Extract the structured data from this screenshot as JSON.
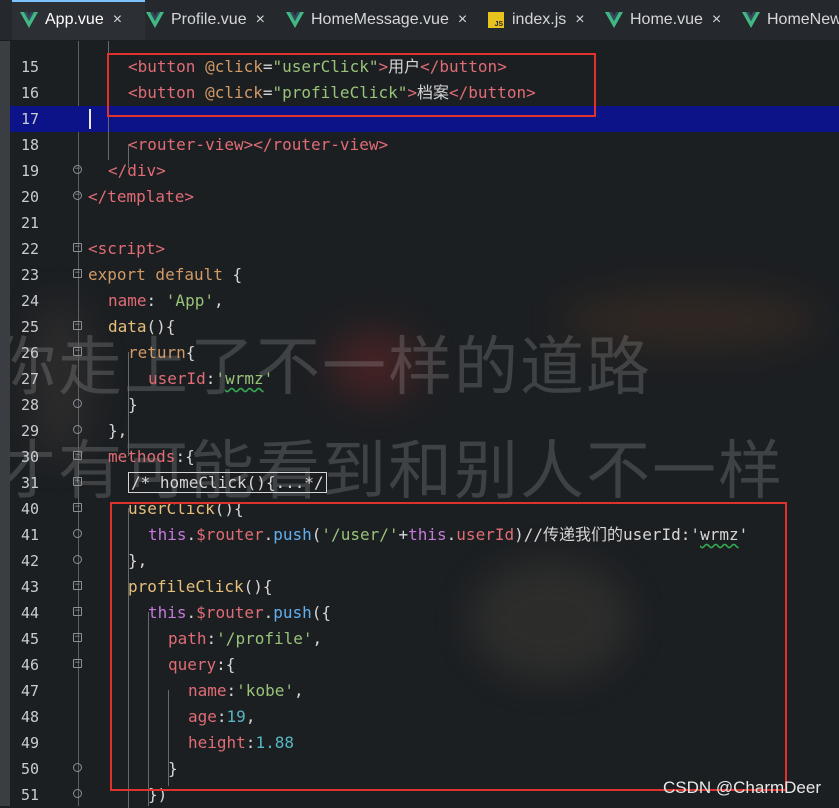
{
  "tabs": [
    {
      "label": "App.vue",
      "icon": "vue-icon",
      "active": true
    },
    {
      "label": "Profile.vue",
      "icon": "vue-icon",
      "active": false
    },
    {
      "label": "HomeMessage.vue",
      "icon": "vue-icon",
      "active": false
    },
    {
      "label": "index.js",
      "icon": "js-icon",
      "active": false
    },
    {
      "label": "Home.vue",
      "icon": "vue-icon",
      "active": false
    },
    {
      "label": "HomeNew",
      "icon": "vue-icon",
      "active": false
    }
  ],
  "close_glyph": "×",
  "background_text": {
    "line1": "你走上了不一样的道路",
    "line2": "才有可能看到和别人不一样"
  },
  "lines": [
    {
      "num": "15",
      "tokens": [
        [
          "t-tag",
          "<button "
        ],
        [
          "t-attr",
          "@click"
        ],
        [
          "t-plain",
          "="
        ],
        [
          "t-str",
          "\"userClick\""
        ],
        [
          "t-tag",
          ">"
        ],
        [
          "t-text",
          "用户"
        ],
        [
          "t-tag",
          "</button>"
        ]
      ]
    },
    {
      "num": "16",
      "tokens": [
        [
          "t-tag",
          "<button "
        ],
        [
          "t-attr",
          "@click"
        ],
        [
          "t-plain",
          "="
        ],
        [
          "t-str",
          "\"profileClick\""
        ],
        [
          "t-tag",
          ">"
        ],
        [
          "t-text",
          "档案"
        ],
        [
          "t-tag",
          "</button>"
        ]
      ]
    },
    {
      "num": "17",
      "tokens": []
    },
    {
      "num": "18",
      "tokens": [
        [
          "t-tag",
          "<router-view></router-view>"
        ]
      ]
    },
    {
      "num": "19",
      "tokens": [
        [
          "t-tag",
          "</div>"
        ]
      ]
    },
    {
      "num": "20",
      "tokens": [
        [
          "t-tag",
          "</template>"
        ]
      ]
    },
    {
      "num": "21",
      "tokens": []
    },
    {
      "num": "22",
      "tokens": [
        [
          "t-tag",
          "<script>"
        ]
      ]
    },
    {
      "num": "23",
      "tokens": [
        [
          "t-kw",
          "export default "
        ],
        [
          "t-plain",
          "{"
        ]
      ]
    },
    {
      "num": "24",
      "tokens": [
        [
          "t-prop",
          "name"
        ],
        [
          "t-plain",
          ": "
        ],
        [
          "t-str",
          "'App'"
        ],
        [
          "t-plain",
          ","
        ]
      ]
    },
    {
      "num": "25",
      "tokens": [
        [
          "t-fn",
          "data"
        ],
        [
          "t-plain",
          "(){"
        ]
      ]
    },
    {
      "num": "26",
      "tokens": [
        [
          "t-kw",
          "return"
        ],
        [
          "t-plain",
          "{"
        ]
      ]
    },
    {
      "num": "27",
      "tokens": [
        [
          "t-prop",
          "userId"
        ],
        [
          "t-plain",
          ":"
        ],
        [
          "t-str",
          "'wrmz'"
        ]
      ]
    },
    {
      "num": "28",
      "tokens": [
        [
          "t-plain",
          "}"
        ]
      ]
    },
    {
      "num": "29",
      "tokens": [
        [
          "t-plain",
          "},"
        ]
      ]
    },
    {
      "num": "30",
      "tokens": [
        [
          "t-prop",
          "methods"
        ],
        [
          "t-plain",
          ":{"
        ]
      ]
    },
    {
      "num": "31",
      "tokens": [
        [
          "t-comment",
          "/* homeClick(){...*/"
        ]
      ]
    },
    {
      "num": "40",
      "tokens": [
        [
          "t-fn",
          "userClick"
        ],
        [
          "t-plain",
          "(){"
        ]
      ]
    },
    {
      "num": "41",
      "tokens": [
        [
          "t-this",
          "this"
        ],
        [
          "t-plain",
          "."
        ],
        [
          "t-prop",
          "$router"
        ],
        [
          "t-plain",
          "."
        ],
        [
          "t-method",
          "push"
        ],
        [
          "t-plain",
          "("
        ],
        [
          "t-str",
          "'/user/'"
        ],
        [
          "t-plain",
          "+"
        ],
        [
          "t-this",
          "this"
        ],
        [
          "t-plain",
          "."
        ],
        [
          "t-prop",
          "userId"
        ],
        [
          "t-plain",
          ")"
        ],
        [
          "t-comment",
          "//传递我们的userId:'wrmz'"
        ]
      ]
    },
    {
      "num": "42",
      "tokens": [
        [
          "t-plain",
          "},"
        ]
      ]
    },
    {
      "num": "43",
      "tokens": [
        [
          "t-fn",
          "profileClick"
        ],
        [
          "t-plain",
          "(){"
        ]
      ]
    },
    {
      "num": "44",
      "tokens": [
        [
          "t-this",
          "this"
        ],
        [
          "t-plain",
          "."
        ],
        [
          "t-prop",
          "$router"
        ],
        [
          "t-plain",
          "."
        ],
        [
          "t-method",
          "push"
        ],
        [
          "t-plain",
          "({"
        ]
      ]
    },
    {
      "num": "45",
      "tokens": [
        [
          "t-prop",
          "path"
        ],
        [
          "t-plain",
          ":"
        ],
        [
          "t-str",
          "'/profile'"
        ],
        [
          "t-plain",
          ","
        ]
      ]
    },
    {
      "num": "46",
      "tokens": [
        [
          "t-prop",
          "query"
        ],
        [
          "t-plain",
          ":{"
        ]
      ]
    },
    {
      "num": "47",
      "tokens": [
        [
          "t-prop",
          "name"
        ],
        [
          "t-plain",
          ":"
        ],
        [
          "t-str",
          "'kobe'"
        ],
        [
          "t-plain",
          ","
        ]
      ]
    },
    {
      "num": "48",
      "tokens": [
        [
          "t-prop",
          "age"
        ],
        [
          "t-plain",
          ":"
        ],
        [
          "t-num",
          "19"
        ],
        [
          "t-plain",
          ","
        ]
      ]
    },
    {
      "num": "49",
      "tokens": [
        [
          "t-prop",
          "height"
        ],
        [
          "t-plain",
          ":"
        ],
        [
          "t-num",
          "1.88"
        ]
      ]
    },
    {
      "num": "50",
      "tokens": [
        [
          "t-plain",
          "}"
        ]
      ]
    },
    {
      "num": "51",
      "tokens": [
        [
          "t-plain",
          "})"
        ]
      ]
    }
  ],
  "watermark": "CSDN @CharmDeer",
  "colors": {
    "highlight_border": "#e0322d",
    "current_line": "#0c1287",
    "vue_green": "#41b883"
  }
}
